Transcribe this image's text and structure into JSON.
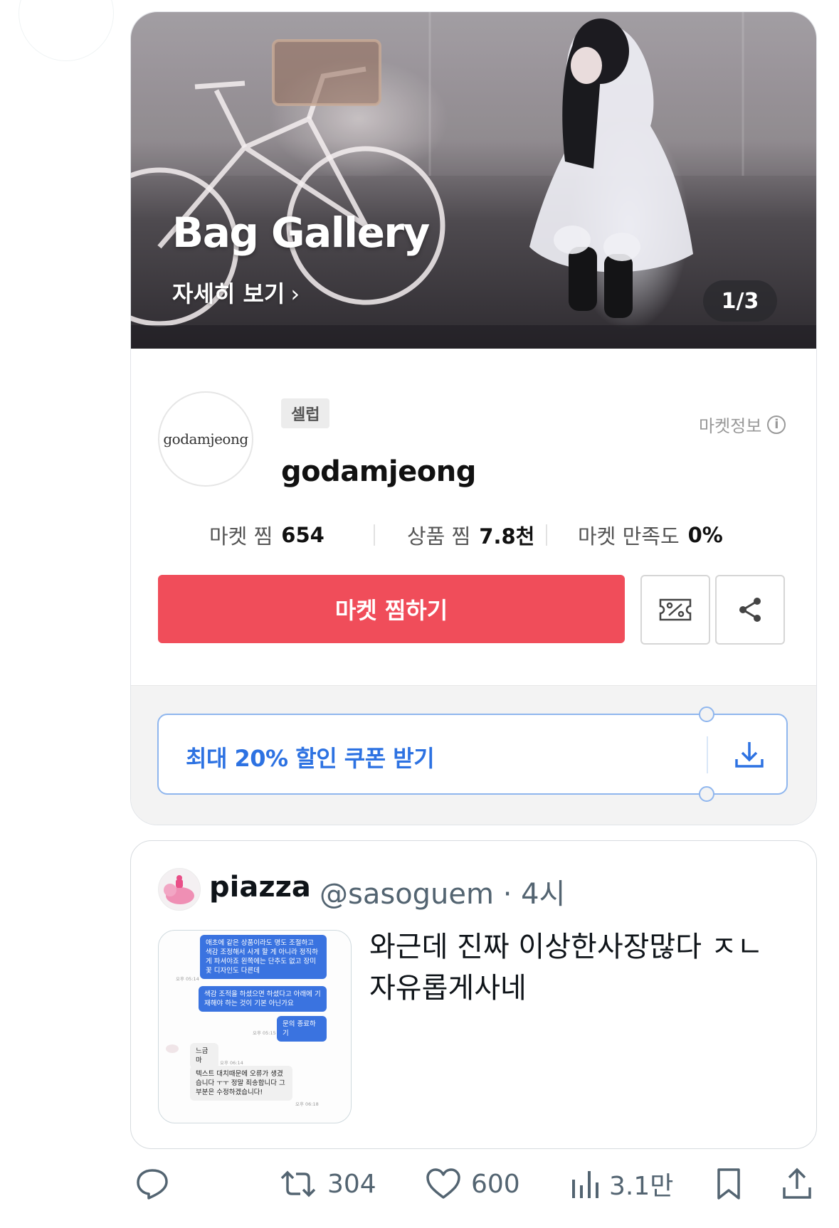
{
  "banner": {
    "title": "Bag Gallery",
    "detail_link": "자세히 보기",
    "chevron": "›",
    "counter": "1/3"
  },
  "shop": {
    "logo_text": "godamjeong",
    "badge": "셀럽",
    "market_info": "마켓정보",
    "info_icon_glyph": "i",
    "name": "godamjeong",
    "stats": [
      {
        "label": "마켓 찜",
        "value": "654"
      },
      {
        "label": "상품 찜",
        "value": "7.8천"
      },
      {
        "label": "마켓 만족도",
        "value": "0%"
      }
    ],
    "favorite_button": "마켓 찜하기",
    "coupon_text": "최대 20% 할인 쿠폰 받기"
  },
  "quote": {
    "name": "piazza",
    "handle_time": "@sasoguem · 4시",
    "text": "와근데 진짜 이상한사장많다 ㅈㄴ\n자유롭게사네",
    "chat": {
      "msg1": "애초에 같은 상품이라도 명도 조절하고 색감 조정해서 사게 할 게 아니라 정직하게 파셔야죠 왼쪽에는 단추도 없고 장미꽃 디자인도 다른데",
      "time1": "오후 05:14",
      "msg2": "색감 조적을 하셨으면 하셨다고 아래에 기재해야 하는 것이 기본 아닌가요",
      "msg3": "문의 종료하기",
      "time2": "오후 05:15",
      "sender": "느금마",
      "time3": "오후 06:14",
      "msg4": "텍스트 대치때문에 오류가 생겼습니다 ㅜㅜ 정말 죄송합니다 그 부분은 수정하겠습니다!",
      "time4": "오후 06:18"
    }
  },
  "actions": {
    "reply": "",
    "retweets": "304",
    "likes": "600",
    "views": "3.1만"
  },
  "colors": {
    "accent_red": "#f04d5a",
    "coupon_blue": "#2d72e2",
    "muted_gray": "#536471"
  }
}
